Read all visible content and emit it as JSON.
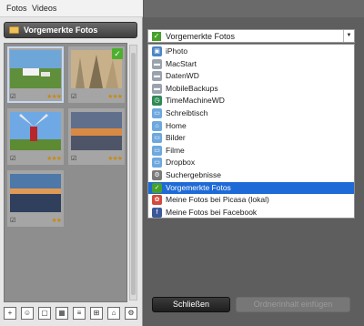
{
  "tabs": [
    "Fotos",
    "Videos"
  ],
  "album": {
    "title": "Vorgemerkte Fotos"
  },
  "thumbs": [
    {
      "stars": "★★★",
      "checked": false,
      "selected": true
    },
    {
      "stars": "★★★",
      "checked": true,
      "selected": false
    },
    {
      "stars": "★★★",
      "checked": false,
      "selected": false
    },
    {
      "stars": "★★★",
      "checked": false,
      "selected": false
    },
    {
      "stars": "★★",
      "checked": false,
      "selected": false
    }
  ],
  "dropdown": {
    "selected": "Vorgemerkte Fotos",
    "items": [
      {
        "label": "iPhoto",
        "icon": "iphoto-icon",
        "color": "#4c86c6",
        "glyph": "▣"
      },
      {
        "label": "MacStart",
        "icon": "drive-icon",
        "color": "#9aa3ad",
        "glyph": "▬"
      },
      {
        "label": "DatenWD",
        "icon": "drive-icon",
        "color": "#9aa3ad",
        "glyph": "▬"
      },
      {
        "label": "MobileBackups",
        "icon": "drive-icon",
        "color": "#9aa3ad",
        "glyph": "▬"
      },
      {
        "label": "TimeMachineWD",
        "icon": "timemachine-icon",
        "color": "#2f8a57",
        "glyph": "◷"
      },
      {
        "label": "Schreibtisch",
        "icon": "desktop-folder-icon",
        "color": "#6ea8de",
        "glyph": "▭"
      },
      {
        "label": "Home",
        "icon": "home-icon",
        "color": "#6ea8de",
        "glyph": "⌂"
      },
      {
        "label": "Bilder",
        "icon": "pictures-folder-icon",
        "color": "#6ea8de",
        "glyph": "▭"
      },
      {
        "label": "Filme",
        "icon": "movies-folder-icon",
        "color": "#6ea8de",
        "glyph": "▭"
      },
      {
        "label": "Dropbox",
        "icon": "dropbox-folder-icon",
        "color": "#6ea8de",
        "glyph": "▭"
      },
      {
        "label": "Suchergebnisse",
        "icon": "search-results-icon",
        "color": "#7a7a7a",
        "glyph": "⚙"
      },
      {
        "label": "Vorgemerkte Fotos",
        "icon": "checkmark-icon",
        "color": "#46a02a",
        "glyph": "✓",
        "highlighted": true
      },
      {
        "label": "Meine Fotos bei Picasa (lokal)",
        "icon": "picasa-icon",
        "color": "#d34b3e",
        "glyph": "✿"
      },
      {
        "label": "Meine Fotos bei Facebook",
        "icon": "facebook-icon",
        "color": "#3b5998",
        "glyph": "f"
      }
    ]
  },
  "buttons": {
    "close": "Schließen",
    "add": "Ordnerinhalt einfügen"
  },
  "toolbar": {
    "icons": [
      "add-icon",
      "people-icon",
      "view-single-icon",
      "view-grid-icon",
      "view-list-icon",
      "view-compare-icon",
      "tag-icon",
      "settings-icon"
    ]
  }
}
